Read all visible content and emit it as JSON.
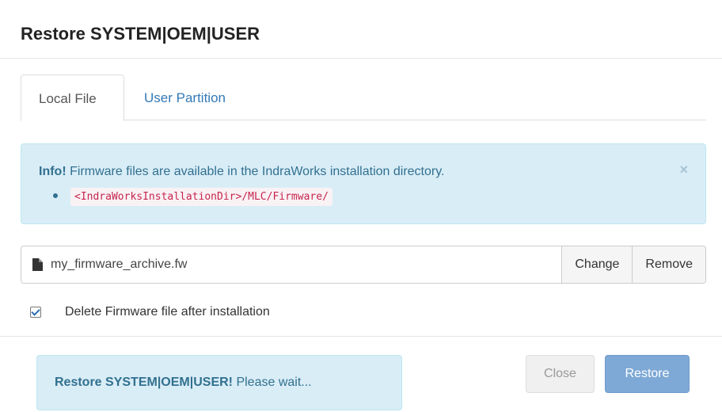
{
  "dialog": {
    "title": "Restore SYSTEM|OEM|USER"
  },
  "tabs": [
    {
      "label": "Local File",
      "active": true
    },
    {
      "label": "User Partition",
      "active": false
    }
  ],
  "info_alert": {
    "prefix": "Info!",
    "message": "Firmware files are available in the IndraWorks installation directory.",
    "path": "<IndraWorksInstallationDir>/MLC/Firmware/",
    "close_symbol": "×"
  },
  "file_input": {
    "filename": "my_firmware_archive.fw",
    "change_label": "Change",
    "remove_label": "Remove"
  },
  "delete_option": {
    "label": "Delete Firmware file after installation",
    "checked": true
  },
  "status": {
    "prefix": "Restore SYSTEM|OEM|USER!",
    "message": "Please wait..."
  },
  "buttons": {
    "close_label": "Close",
    "restore_label": "Restore"
  },
  "colors": {
    "info_bg": "#d9edf7",
    "info_text": "#31708f",
    "link": "#337ab7",
    "primary_disabled": "#7ea9d6"
  }
}
